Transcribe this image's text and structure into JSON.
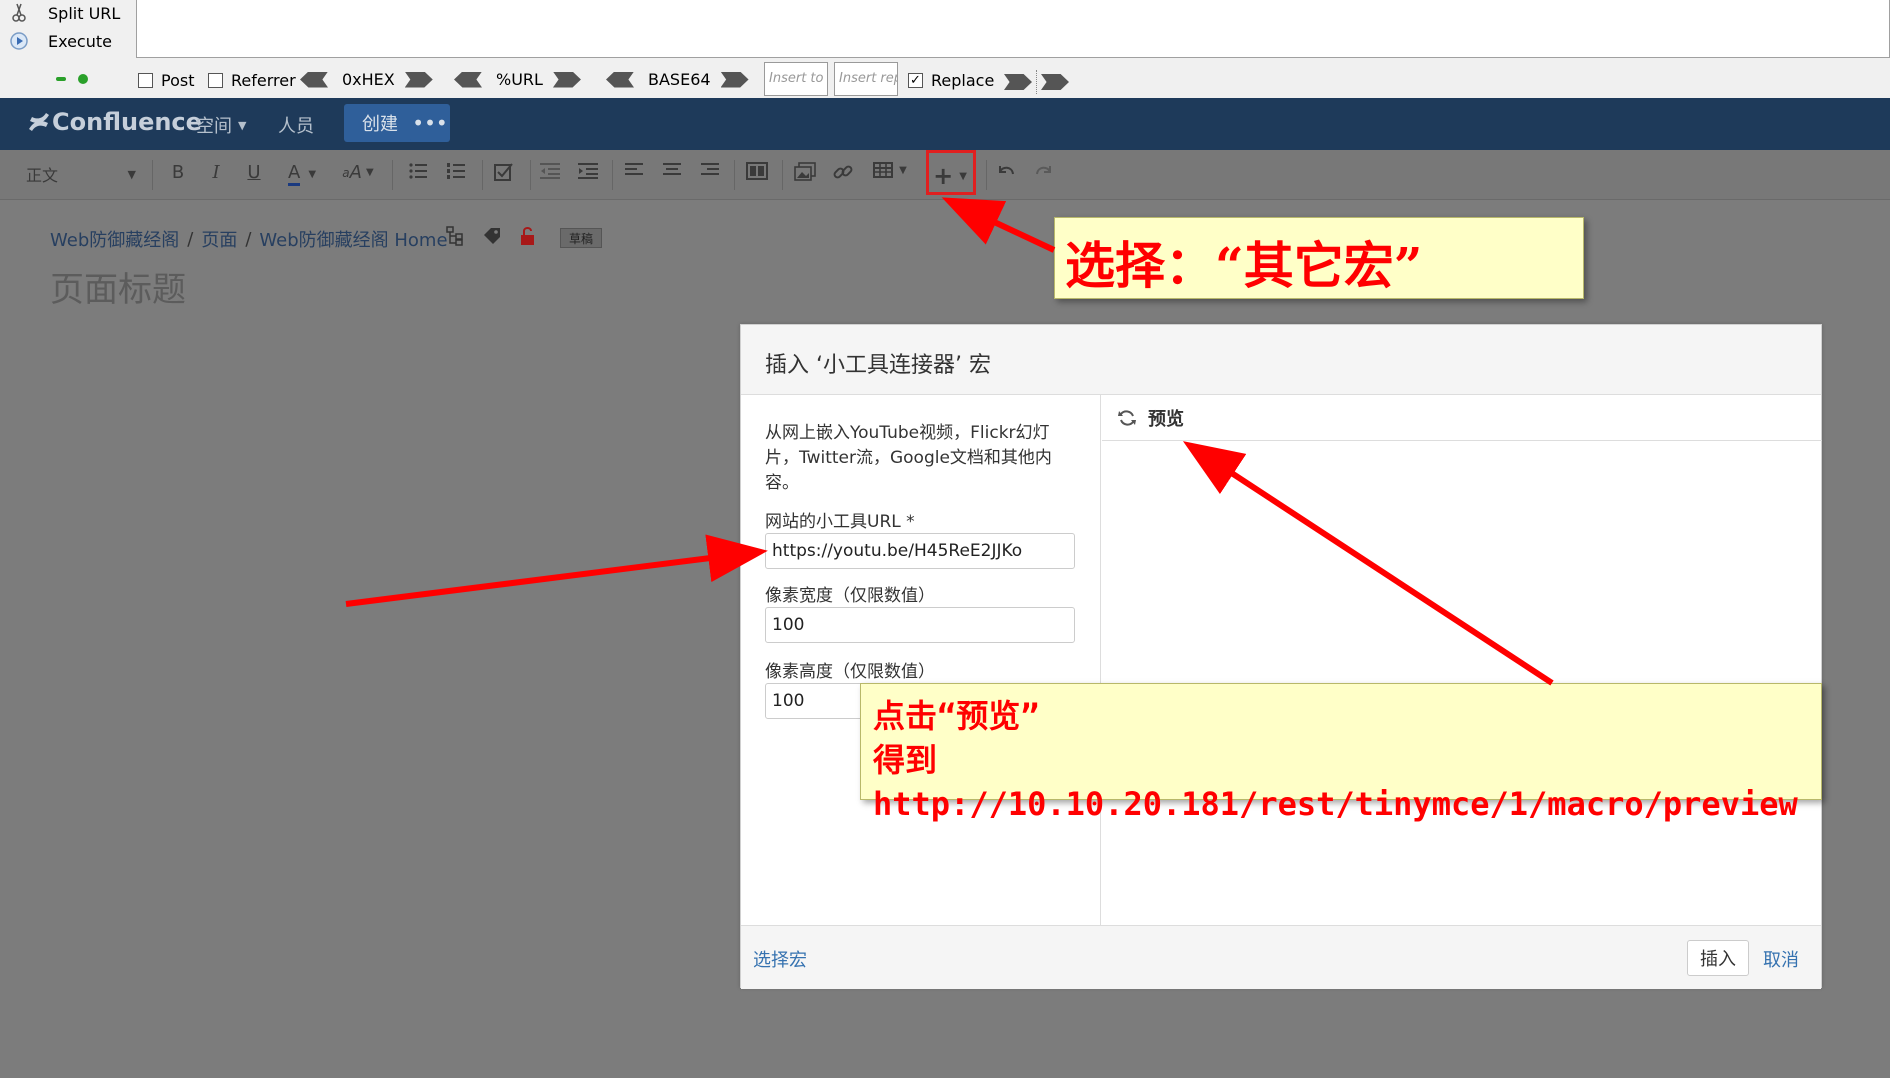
{
  "hackbar": {
    "split_url": "Split URL",
    "execute": "Execute",
    "post": "Post",
    "referrer": "Referrer",
    "hex": "0xHEX",
    "url_enc": "%URL",
    "base64": "BASE64",
    "insert_to_placeholder": "Insert to r",
    "insert_rep_placeholder": "Insert rep",
    "replace": "Replace",
    "replace_checked": true
  },
  "header": {
    "logo": "Confluence",
    "spaces": "空间",
    "people": "人员",
    "create": "创建",
    "more": "•••"
  },
  "toolbar": {
    "style": "正文",
    "bold": "B",
    "italic": "I",
    "underline": "U",
    "font_color": "A"
  },
  "breadcrumb": {
    "space": "Web防御藏经阁",
    "pages": "页面",
    "home": "Web防御藏经阁 Home",
    "draft": "草稿"
  },
  "page": {
    "title_placeholder": "页面标题"
  },
  "dialog": {
    "title": "插入 ‘小工具连接器’ 宏",
    "description": "从网上嵌入YouTube视频，Flickr幻灯片，Twitter流，Google文档和其他内容。",
    "url_label": "网站的小工具URL *",
    "url_value": "https://youtu.be/H45ReE2JJKo",
    "width_label": "像素宽度（仅限数值）",
    "width_value": "100",
    "height_label": "像素高度（仅限数值）",
    "height_value": "100",
    "preview": "预览",
    "select_macro": "选择宏",
    "insert": "插入",
    "cancel": "取消"
  },
  "annotations": {
    "note1": "选择：“其它宏”",
    "note2_line1": "点击“预览”",
    "note2_line2": "得到http://10.10.20.181/rest/tinymce/1/macro/preview"
  },
  "colors": {
    "header_bg": "#1e3a5a",
    "annotation_red": "#ff0000",
    "note_bg": "#ffffc8",
    "link_blue": "#3572b0"
  }
}
